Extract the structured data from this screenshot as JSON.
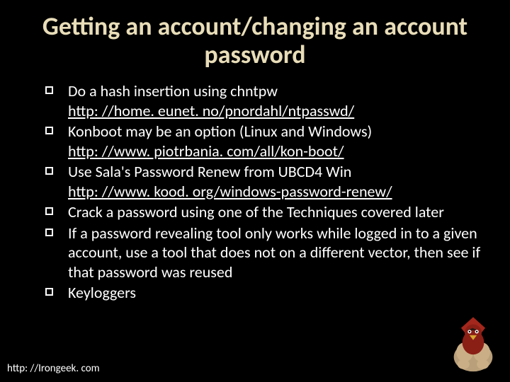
{
  "title": "Getting an account/changing an account password",
  "bullets": [
    {
      "text": "Do a hash insertion using chntpw",
      "link": "http: //home. eunet. no/pnordahl/ntpasswd/"
    },
    {
      "text": "Konboot may be an option (Linux and Windows)",
      "link": "http: //www. piotrbania. com/all/kon-boot/"
    },
    {
      "text": "Use Sala's Password Renew from UBCD4 Win",
      "link": "http: //www. kood. org/windows-password-renew/"
    },
    {
      "text": "Crack a password using one of the Techniques covered later",
      "link": ""
    },
    {
      "text": "If a password revealing tool only works while logged in to a given account, use a tool that does not on a different vector, then see if that password was reused",
      "link": ""
    },
    {
      "text": "Keyloggers",
      "link": ""
    }
  ],
  "footer": "http: //Irongeek. com",
  "mascot_name": "mascot-bird-icon"
}
